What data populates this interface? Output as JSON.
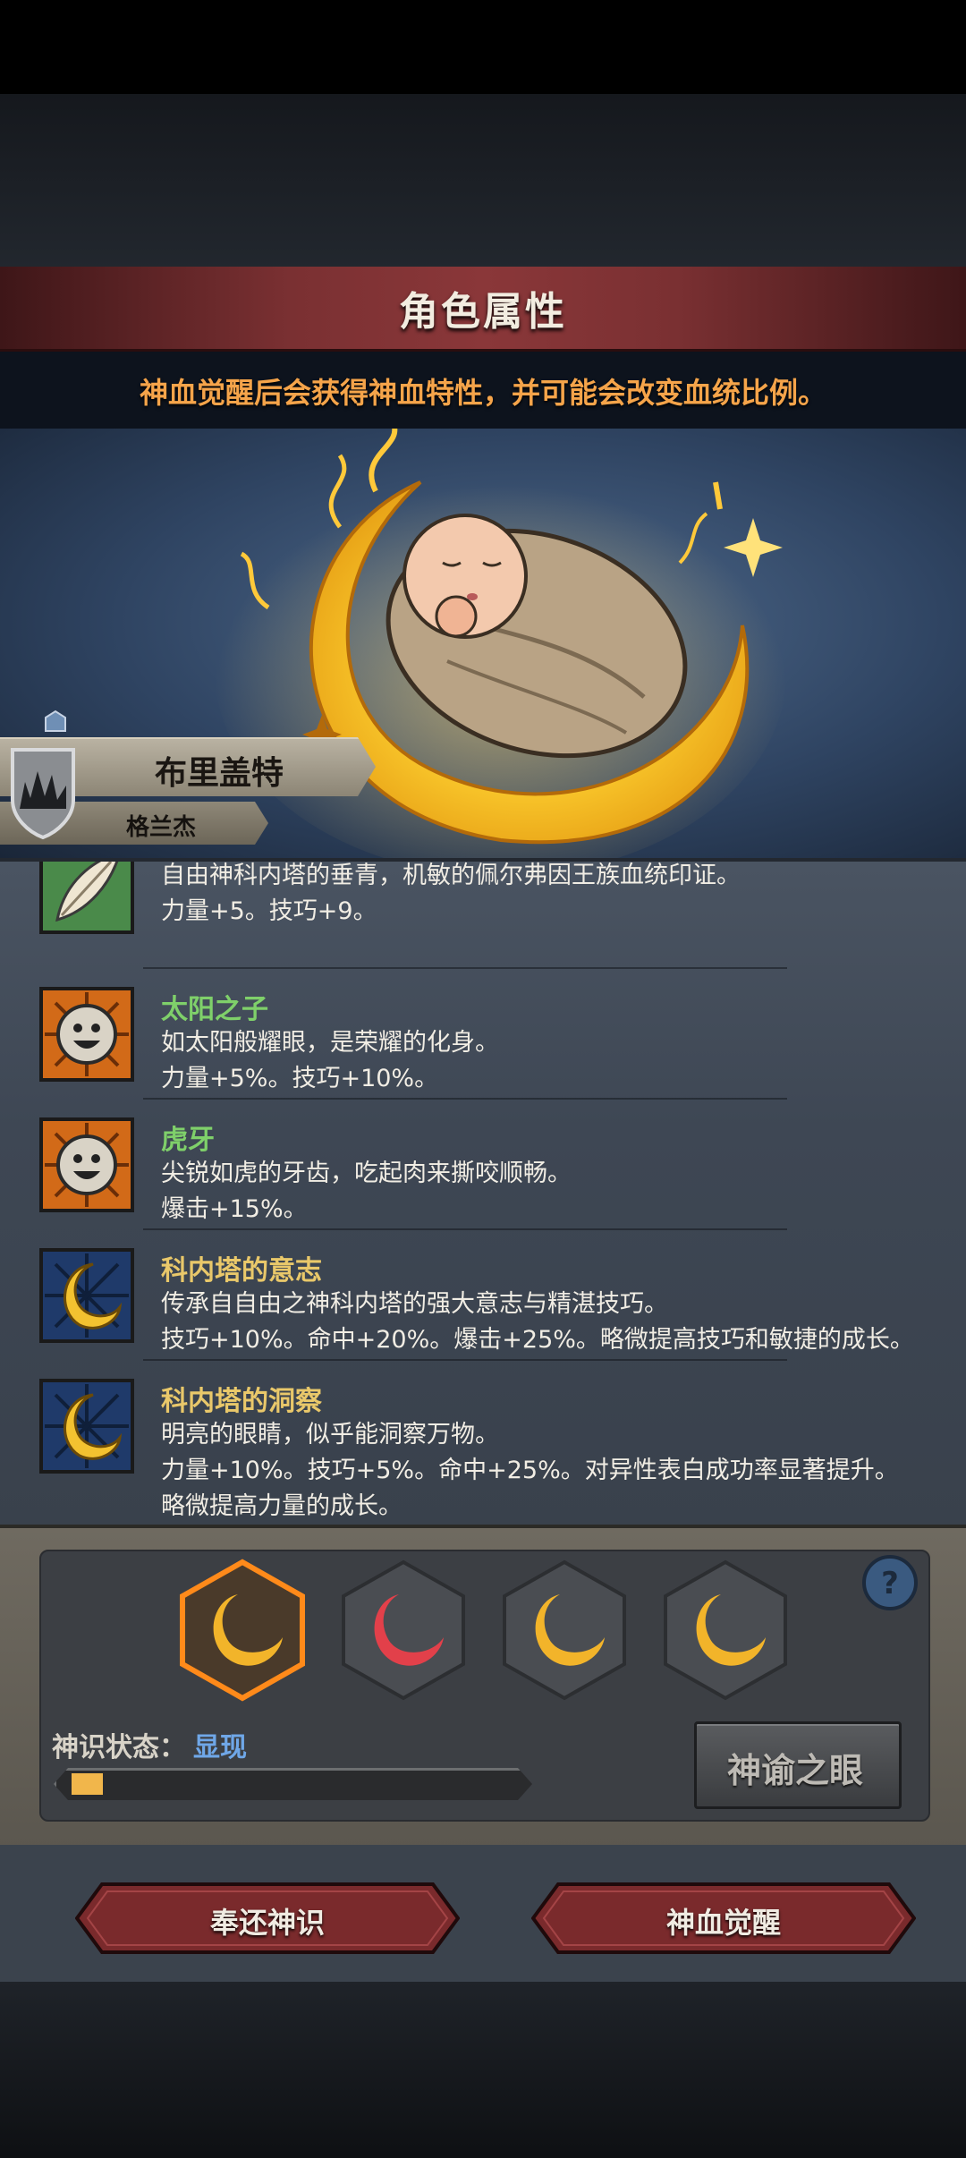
{
  "header": {
    "title": "角色属性",
    "hint": "神血觉醒后会获得神血特性，并可能会改变血统比例。"
  },
  "character": {
    "name": "布里盖特",
    "origin": "格兰杰"
  },
  "traits": [
    {
      "name": "",
      "desc": "自由神科内塔的垂青，机敏的佩尔弗因王族血统印证。",
      "stats": "力量+5。技巧+9。",
      "name_color": "#7fd06a",
      "icon": "white-feather-icon"
    },
    {
      "name": "太阳之子",
      "desc": "如太阳般耀眼，是荣耀的化身。",
      "stats": "力量+5%。技巧+10%。",
      "name_color": "#7fd06a",
      "icon": "smiling-sun-icon"
    },
    {
      "name": "虎牙",
      "desc": "尖锐如虎的牙齿，吃起肉来撕咬顺畅。",
      "stats": "爆击+15%。",
      "name_color": "#7fd06a",
      "icon": "smiling-sun-icon"
    },
    {
      "name": "科内塔的意志",
      "desc": "传承自自由之神科内塔的强大意志与精湛技巧。",
      "stats": "技巧+10%。命中+20%。爆击+25%。略微提高技巧和敏捷的成长。",
      "name_color": "#e9c86a",
      "icon": "golden-moon-icon"
    },
    {
      "name": "科内塔的洞察",
      "desc": "明亮的眼睛，似乎能洞察万物。",
      "stats": "力量+10%。技巧+5%。命中+25%。对异性表白成功率显著提升。",
      "stats2": "略微提高力量的成长。",
      "name_color": "#e9c86a",
      "icon": "golden-moon-icon"
    }
  ],
  "divine": {
    "status_label": "神识状态：",
    "status_value": "显现",
    "progress": 0.07,
    "oracle_button": "神谕之眼",
    "slots": [
      {
        "icon": "gold-moon-icon",
        "color": "#f2b42a",
        "selected": true
      },
      {
        "icon": "red-moon-icon",
        "color": "#e2404a",
        "selected": false
      },
      {
        "icon": "gold-moon-icon",
        "color": "#f2b42a",
        "selected": false
      },
      {
        "icon": "gold-moon-icon",
        "color": "#f2b42a",
        "selected": false
      }
    ]
  },
  "buttons": {
    "return": "奉还神识",
    "awaken": "神血觉醒"
  }
}
